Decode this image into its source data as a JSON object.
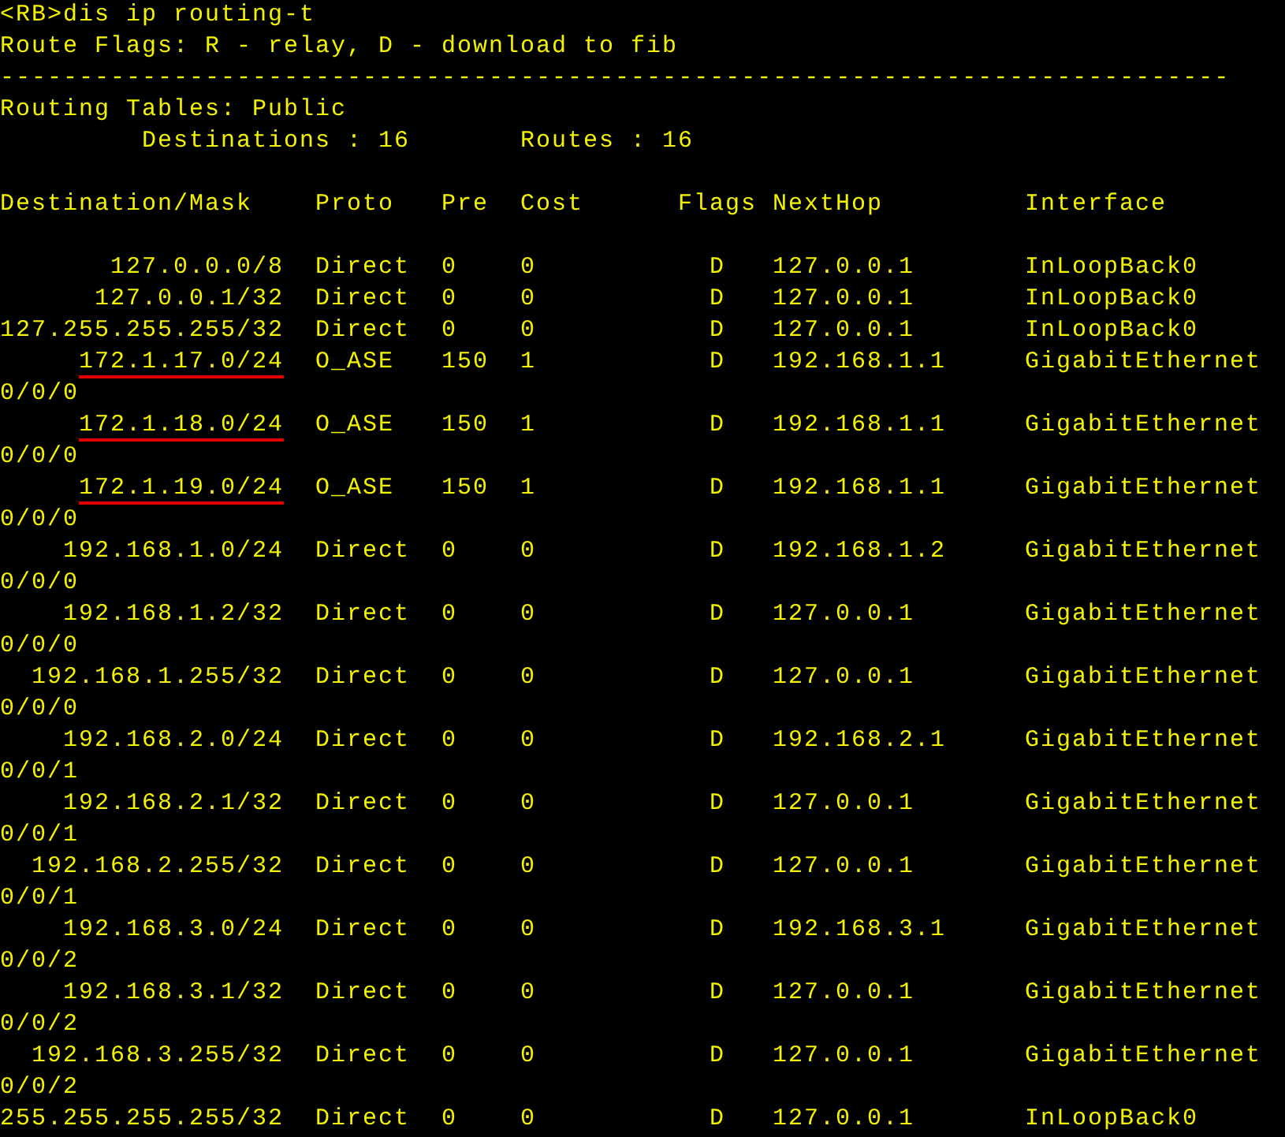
{
  "terminal": {
    "command_line": "<RB>dis ip routing-t",
    "flags_legend": "Route Flags: R - relay, D - download to fib",
    "separator": "------------------------------------------------------------------------------",
    "table_title": "Routing Tables: Public",
    "destinations": "Destinations : 16",
    "routes_count": "Routes : 16",
    "columns": [
      "Destination/Mask",
      "Proto",
      "Pre",
      "Cost",
      "Flags",
      "NextHop",
      "Interface"
    ],
    "routes": [
      {
        "destination": "127.0.0.0/8",
        "proto": "Direct",
        "pre": "0",
        "cost": "0",
        "flags": "D",
        "nexthop": "127.0.0.1",
        "interface": "InLoopBack0",
        "underlined": false
      },
      {
        "destination": "127.0.0.1/32",
        "proto": "Direct",
        "pre": "0",
        "cost": "0",
        "flags": "D",
        "nexthop": "127.0.0.1",
        "interface": "InLoopBack0",
        "underlined": false
      },
      {
        "destination": "127.255.255.255/32",
        "proto": "Direct",
        "pre": "0",
        "cost": "0",
        "flags": "D",
        "nexthop": "127.0.0.1",
        "interface": "InLoopBack0",
        "underlined": false
      },
      {
        "destination": "172.1.17.0/24",
        "proto": "O_ASE",
        "pre": "150",
        "cost": "1",
        "flags": "D",
        "nexthop": "192.168.1.1",
        "interface": "GigabitEthernet",
        "interface_wrap": "0/0/0",
        "underlined": true
      },
      {
        "destination": "172.1.18.0/24",
        "proto": "O_ASE",
        "pre": "150",
        "cost": "1",
        "flags": "D",
        "nexthop": "192.168.1.1",
        "interface": "GigabitEthernet",
        "interface_wrap": "0/0/0",
        "underlined": true
      },
      {
        "destination": "172.1.19.0/24",
        "proto": "O_ASE",
        "pre": "150",
        "cost": "1",
        "flags": "D",
        "nexthop": "192.168.1.1",
        "interface": "GigabitEthernet",
        "interface_wrap": "0/0/0",
        "underlined": true
      },
      {
        "destination": "192.168.1.0/24",
        "proto": "Direct",
        "pre": "0",
        "cost": "0",
        "flags": "D",
        "nexthop": "192.168.1.2",
        "interface": "GigabitEthernet",
        "interface_wrap": "0/0/0",
        "underlined": false
      },
      {
        "destination": "192.168.1.2/32",
        "proto": "Direct",
        "pre": "0",
        "cost": "0",
        "flags": "D",
        "nexthop": "127.0.0.1",
        "interface": "GigabitEthernet",
        "interface_wrap": "0/0/0",
        "underlined": false
      },
      {
        "destination": "192.168.1.255/32",
        "proto": "Direct",
        "pre": "0",
        "cost": "0",
        "flags": "D",
        "nexthop": "127.0.0.1",
        "interface": "GigabitEthernet",
        "interface_wrap": "0/0/0",
        "underlined": false
      },
      {
        "destination": "192.168.2.0/24",
        "proto": "Direct",
        "pre": "0",
        "cost": "0",
        "flags": "D",
        "nexthop": "192.168.2.1",
        "interface": "GigabitEthernet",
        "interface_wrap": "0/0/1",
        "underlined": false
      },
      {
        "destination": "192.168.2.1/32",
        "proto": "Direct",
        "pre": "0",
        "cost": "0",
        "flags": "D",
        "nexthop": "127.0.0.1",
        "interface": "GigabitEthernet",
        "interface_wrap": "0/0/1",
        "underlined": false
      },
      {
        "destination": "192.168.2.255/32",
        "proto": "Direct",
        "pre": "0",
        "cost": "0",
        "flags": "D",
        "nexthop": "127.0.0.1",
        "interface": "GigabitEthernet",
        "interface_wrap": "0/0/1",
        "underlined": false
      },
      {
        "destination": "192.168.3.0/24",
        "proto": "Direct",
        "pre": "0",
        "cost": "0",
        "flags": "D",
        "nexthop": "192.168.3.1",
        "interface": "GigabitEthernet",
        "interface_wrap": "0/0/2",
        "underlined": false
      },
      {
        "destination": "192.168.3.1/32",
        "proto": "Direct",
        "pre": "0",
        "cost": "0",
        "flags": "D",
        "nexthop": "127.0.0.1",
        "interface": "GigabitEthernet",
        "interface_wrap": "0/0/2",
        "underlined": false
      },
      {
        "destination": "192.168.3.255/32",
        "proto": "Direct",
        "pre": "0",
        "cost": "0",
        "flags": "D",
        "nexthop": "127.0.0.1",
        "interface": "GigabitEthernet",
        "interface_wrap": "0/0/2",
        "underlined": false
      },
      {
        "destination": "255.255.255.255/32",
        "proto": "Direct",
        "pre": "0",
        "cost": "0",
        "flags": "D",
        "nexthop": "127.0.0.1",
        "interface": "InLoopBack0",
        "underlined": false
      }
    ]
  }
}
